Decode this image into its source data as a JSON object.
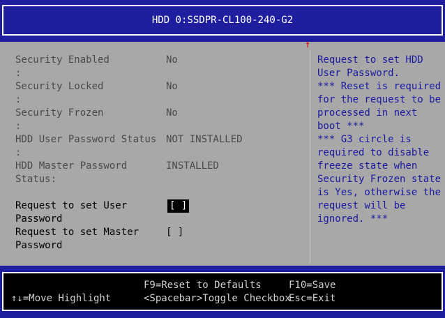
{
  "header": {
    "title": "HDD 0:SSDPR-CL100-240-G2"
  },
  "scroll_indicator": "↑",
  "settings": [
    {
      "label": "Security Enabled\n:",
      "value": "No"
    },
    {
      "label": "Security Locked\n:",
      "value": "No"
    },
    {
      "label": "Security Frozen\n:",
      "value": "No"
    },
    {
      "label": "HDD User Password Status\n:",
      "value": "NOT INSTALLED"
    },
    {
      "label": "HDD Master Password\nStatus:",
      "value": "INSTALLED"
    }
  ],
  "requests": [
    {
      "label": "Request to set User\nPassword",
      "checkbox": "[ ]",
      "selected": true
    },
    {
      "label": "Request to set Master\nPassword",
      "checkbox": "[ ]",
      "selected": false
    }
  ],
  "help_text": "Request to set HDD\nUser Password.\n*** Reset is required\nfor the request to be\nprocessed in next\nboot ***\n*** G3 circle is\nrequired to disable\nfreeze state when\nSecurity Frozen state\nis Yes, otherwise the\nrequest will be\nignored. ***",
  "footer": {
    "move": "↑↓=Move Highlight",
    "f9": "F9=Reset to Defaults",
    "f10": "F10=Save",
    "spacebar": "<Spacebar>Toggle Checkbox",
    "esc": "Esc=Exit"
  },
  "colors": {
    "background": "#a8a8a8",
    "band": "#1e1e9e",
    "help_text": "#1a1aa0",
    "arrow": "#e00000"
  }
}
